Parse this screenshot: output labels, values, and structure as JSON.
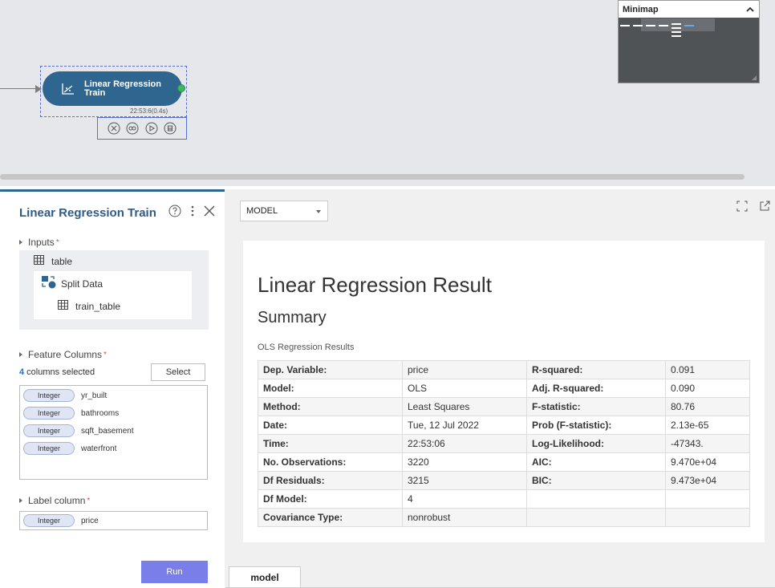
{
  "canvas": {
    "node": {
      "label": "Linear Regression Train",
      "time": "22:53:6(0.4s)"
    },
    "minimap": {
      "title": "Minimap"
    }
  },
  "left_panel": {
    "title": "Linear Regression Train",
    "inputs": {
      "label": "Inputs",
      "required_mark": "*",
      "table": "table",
      "source": "Split Data",
      "source_table": "train_table"
    },
    "feature_columns": {
      "label": "Feature Columns",
      "required_mark": "*",
      "count": "4",
      "count_suffix": " columns selected",
      "select_label": "Select",
      "items": [
        {
          "type": "Integer",
          "name": "yr_built"
        },
        {
          "type": "Integer",
          "name": "bathrooms"
        },
        {
          "type": "Integer",
          "name": "sqft_basement"
        },
        {
          "type": "Integer",
          "name": "waterfront"
        }
      ]
    },
    "label_column": {
      "label": "Label column",
      "required_mark": "*",
      "type": "Integer",
      "name": "price"
    },
    "run_label": "Run"
  },
  "right_panel": {
    "dropdown_value": "MODEL",
    "title": "Linear Regression Result",
    "subtitle": "Summary",
    "caption": "OLS Regression Results",
    "rows": [
      [
        "Dep. Variable:",
        "price",
        "R-squared:",
        "0.091"
      ],
      [
        "Model:",
        "OLS",
        "Adj. R-squared:",
        "0.090"
      ],
      [
        "Method:",
        "Least Squares",
        "F-statistic:",
        "80.76"
      ],
      [
        "Date:",
        "Tue, 12 Jul 2022",
        "Prob (F-statistic):",
        "2.13e-65"
      ],
      [
        "Time:",
        "22:53:06",
        "Log-Likelihood:",
        "-47343."
      ],
      [
        "No. Observations:",
        "3220",
        "AIC:",
        "9.470e+04"
      ],
      [
        "Df Residuals:",
        "3215",
        "BIC:",
        "9.473e+04"
      ],
      [
        "Df Model:",
        "4",
        "",
        ""
      ],
      [
        "Covariance Type:",
        "nonrobust",
        "",
        ""
      ]
    ],
    "tab_label": "model"
  },
  "colors": {
    "node": "#2f6690",
    "run_button": "#7a7ee8",
    "title": "#2f5a85",
    "required": "#e34d4d"
  }
}
